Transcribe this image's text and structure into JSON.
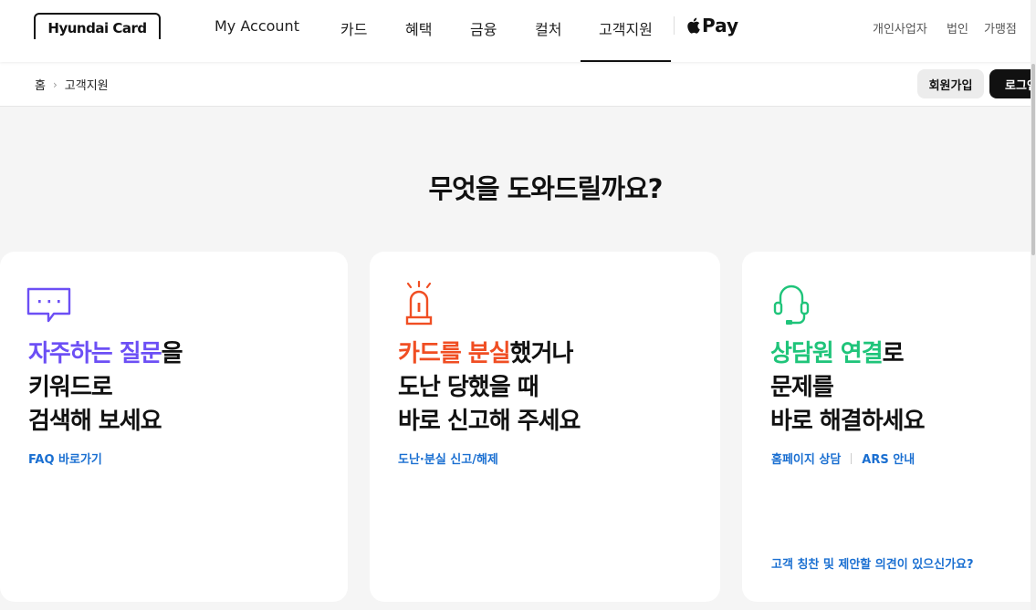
{
  "header": {
    "logo_text": "Hyundai Card",
    "nav": [
      {
        "label": "My Account"
      },
      {
        "label": "카드"
      },
      {
        "label": "혜택"
      },
      {
        "label": "금융"
      },
      {
        "label": "컬처"
      },
      {
        "label": "고객지원",
        "active": true
      }
    ],
    "applepay_label": "Pay",
    "util_links": [
      "개인사업자",
      "법인",
      "가맹점"
    ]
  },
  "subbar": {
    "breadcrumb": [
      "홈",
      "고객지원"
    ],
    "join_label": "회원가입",
    "login_label": "로그인"
  },
  "main": {
    "title": "무엇을 도와드릴까요?",
    "cards": [
      {
        "icon": "chat-bubble-icon",
        "accent_color": "#6c4ff5",
        "headline_highlight": "자주하는 질문",
        "headline_rest": "을",
        "headline_line2": "키워드로",
        "headline_line3": "검색해 보세요",
        "links": [
          "FAQ 바로가기"
        ]
      },
      {
        "icon": "siren-icon",
        "accent_color": "#f04e23",
        "headline_highlight": "카드를 분실",
        "headline_rest": "했거나",
        "headline_line2": "도난 당했을 때",
        "headline_line3": "바로 신고해 주세요",
        "links": [
          "도난·분실 신고/해제"
        ]
      },
      {
        "icon": "headset-icon",
        "accent_color": "#1fc47a",
        "headline_highlight": "상담원 연결",
        "headline_rest": "로",
        "headline_line2": "문제를",
        "headline_line3": "바로 해결하세요",
        "links": [
          "홈페이지 상담",
          "ARS 안내"
        ],
        "bottom_link": "고객 칭찬 및 제안할 의견이 있으신가요?"
      }
    ]
  },
  "colors": {
    "link_blue": "#1a6fd1",
    "background": "#f5f5f5"
  }
}
